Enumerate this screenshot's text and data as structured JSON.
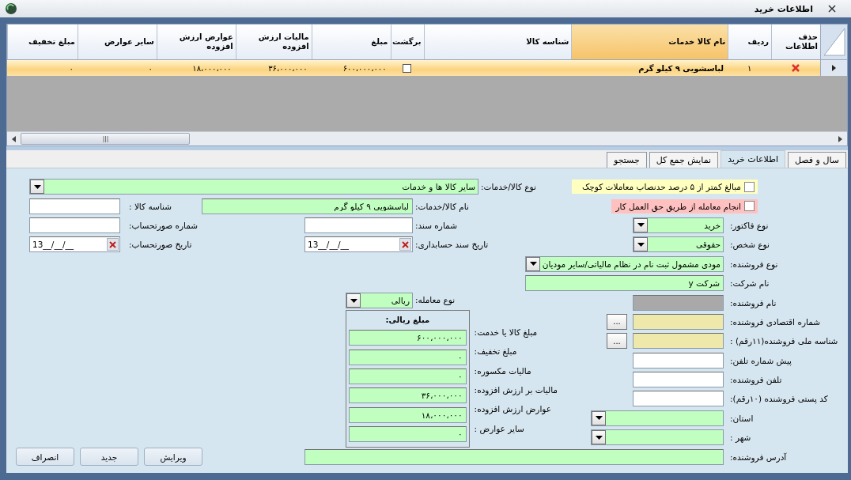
{
  "window": {
    "title": "اطلاعات خرید"
  },
  "table": {
    "columns": [
      {
        "label": "حذف اطلاعات",
        "selected": false
      },
      {
        "label": "ردیف",
        "selected": false
      },
      {
        "label": "نام کالا خدمات",
        "selected": true
      },
      {
        "label": "شناسه کالا",
        "selected": false
      },
      {
        "label": "برگشت",
        "selected": false
      },
      {
        "label": "مبلغ",
        "selected": false
      },
      {
        "label": "مالیات ارزش افزوده",
        "selected": false
      },
      {
        "label": "عوارض ارزش افزوده",
        "selected": false
      },
      {
        "label": "سایر عوارض",
        "selected": false
      },
      {
        "label": "مبلغ تخفیف",
        "selected": false
      }
    ],
    "rows": [
      {
        "selected": true,
        "number": "۱",
        "name": "لباسشویی ۹ کیلو گرم",
        "returned": false,
        "amount": "۶۰۰،۰۰۰،۰۰۰",
        "vat": "۳۶،۰۰۰،۰۰۰",
        "vat_duties": "۱۸،۰۰۰،۰۰۰",
        "other_duties": "۰",
        "discount": "۰"
      }
    ]
  },
  "tabs": [
    {
      "label": "سال و فصل",
      "selected": false
    },
    {
      "label": "اطلاعات خرید",
      "selected": true
    },
    {
      "label": "نمایش جمع کل",
      "selected": false
    },
    {
      "label": "جستجو",
      "selected": false
    }
  ],
  "fields": [
    {
      "kind": "checkbox",
      "label": "مبالغ کمتر از ۵ درصد حدنصاب معاملات  کوچک",
      "checked": false,
      "color": "#ffffc0"
    },
    {
      "kind": "combo",
      "label": "نوع کالا/خدمات:",
      "value": "سایر کالا ها و خدمات",
      "color": "#c0ffc0"
    },
    {
      "kind": "checkbox",
      "label": "انجام معامله از طریق حق العمل کار",
      "checked": false,
      "color": "#ffc0c0"
    },
    {
      "kind": "text",
      "label": "نام کالا/خدمات:",
      "value": "لباسشویی ۹ کیلو گرم",
      "color": "#c0ffc0"
    },
    {
      "kind": "text",
      "label": "شناسه کالا :",
      "color": "#ffffff"
    },
    {
      "kind": "combo",
      "label": "نوع فاکتور:",
      "value": "خرید",
      "color": "#c0ffc0"
    },
    {
      "kind": "text",
      "label": "شماره سند:",
      "color": "#ffffff"
    },
    {
      "kind": "text",
      "label": "شماره صورتحساب:",
      "color": "#ffffff"
    },
    {
      "kind": "combo",
      "label": "نوع شخص:",
      "value": "حقوقی",
      "color": "#c0ffc0"
    },
    {
      "kind": "date",
      "label": "تاریخ سند حسابداری:",
      "value": "13__/__/__",
      "color": "#ffffff"
    },
    {
      "kind": "date",
      "label": "تاریخ صورتحساب:",
      "value": "13__/__/__",
      "color": "#ffffff"
    },
    {
      "kind": "combo",
      "label": "نوع فروشنده:",
      "value": "مودی مشمول ثبت نام در نظام مالیاتی/سایر مودیان",
      "color": "#c0ffc0"
    },
    {
      "kind": "text",
      "label": "نام شرکت:",
      "value": "شرکت y",
      "color": "#c0ffc0"
    },
    {
      "kind": "text",
      "label": "نام فروشنده:",
      "color": "#a9a9a9"
    },
    {
      "kind": "combo",
      "label": "نوع معامله:",
      "value": "ریالی",
      "color": "#c0ffc0"
    },
    {
      "kind": "lookup",
      "label": "شماره اقتصادی فروشنده:",
      "button": "...",
      "color": "#eee8aa"
    },
    {
      "kind": "lookup",
      "label": "شناسه ملی فروشنده(۱۱رقم) :",
      "button": "...",
      "color": "#eee8aa"
    },
    {
      "kind": "text",
      "label": "پیش شماره تلفن:",
      "color": "#ffffff"
    },
    {
      "kind": "text",
      "label": "تلفن فروشنده:",
      "color": "#ffffff"
    },
    {
      "kind": "text",
      "label": "کد پستی فروشنده (۱۰رقم):",
      "color": "#ffffff"
    },
    {
      "kind": "combo",
      "label": "استان:",
      "color": "#c0ffc0"
    },
    {
      "kind": "combo",
      "label": "شهر :",
      "color": "#c0ffc0"
    },
    {
      "kind": "text",
      "label": "آدرس فروشنده:",
      "color": "#c0ffc0"
    }
  ],
  "amounts": {
    "title": "مبلغ ریالی:",
    "rows": [
      {
        "label": "مبلغ کالا یا خدمت:",
        "value": "۶۰۰،۰۰۰،۰۰۰"
      },
      {
        "label": "مبلغ تخفیف:",
        "value": "۰"
      },
      {
        "label": "مالیات مکسوره:",
        "value": "۰"
      },
      {
        "label": "مالیات بر ارزش افزوده:",
        "value": "۳۶،۰۰۰،۰۰۰"
      },
      {
        "label": "عوارض ارزش افزوده:",
        "value": "۱۸،۰۰۰،۰۰۰"
      },
      {
        "label": "سایر عوارض :",
        "value": "۰"
      }
    ]
  },
  "buttons": [
    "ویرایش",
    "جدید",
    "انصراف"
  ]
}
